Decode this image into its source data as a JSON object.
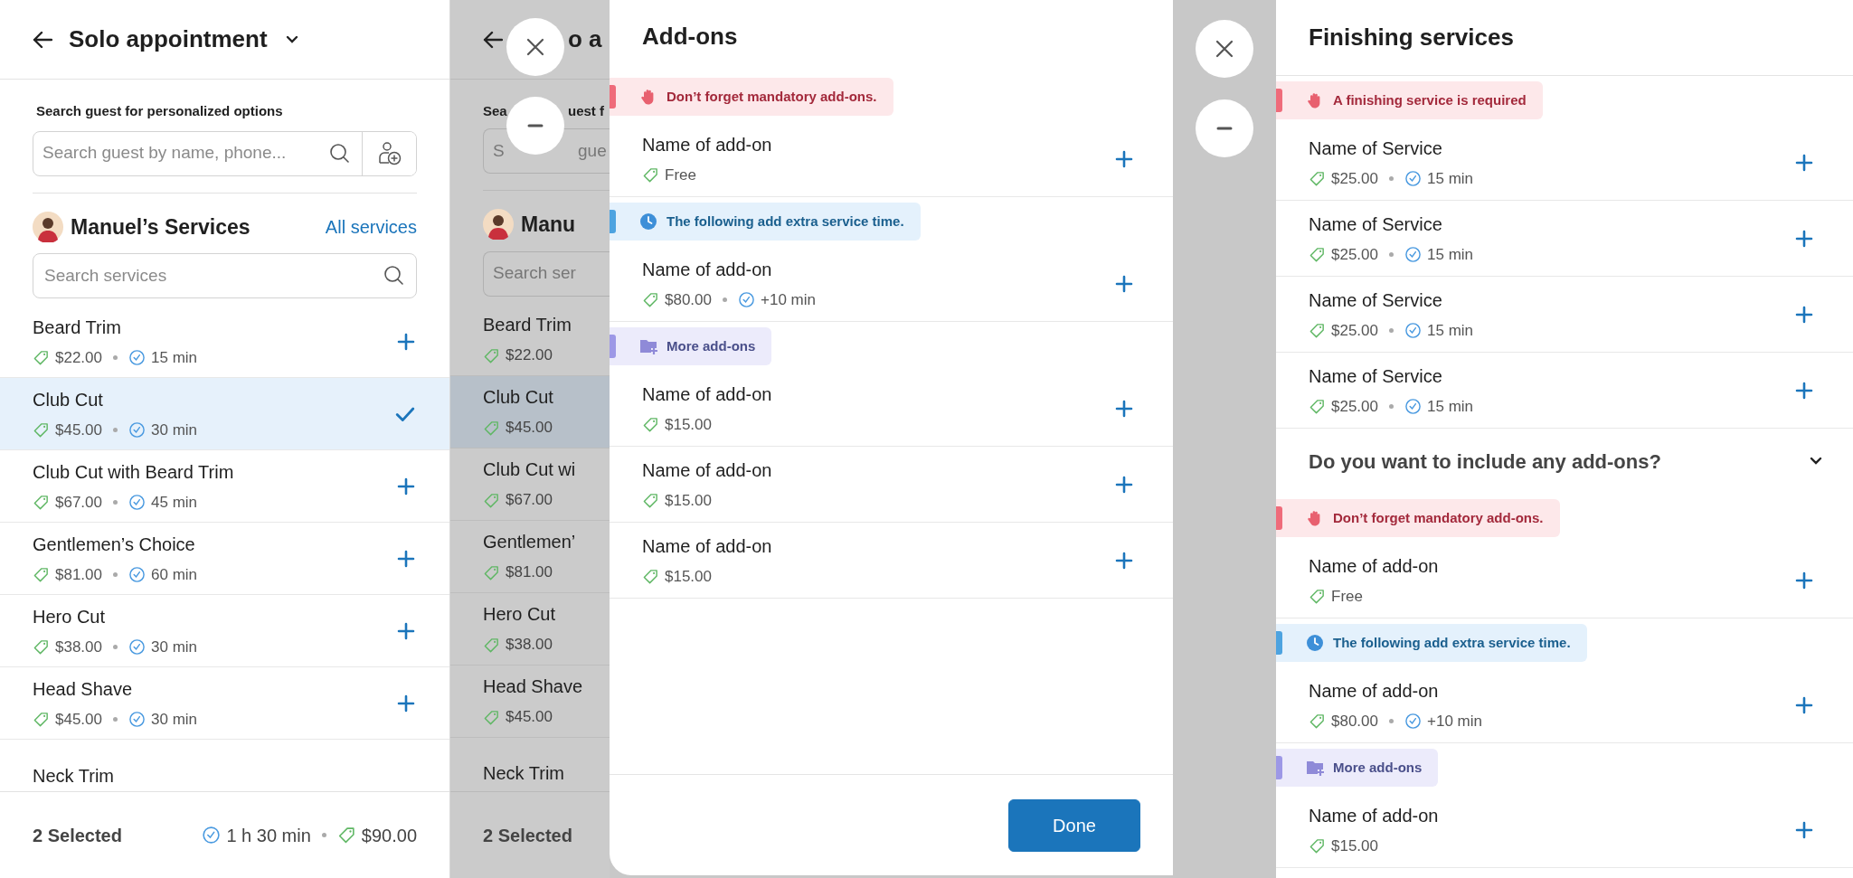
{
  "booking": {
    "title": "Solo appointment",
    "guest_label": "Search guest for personalized options",
    "guest_search": {
      "placeholder": "Search guest by name, phone..."
    },
    "staff_name": "Manuel’s Services",
    "all_services_link": "All services",
    "service_search": {
      "placeholder": "Search services"
    },
    "services": [
      {
        "name": "Beard Trim",
        "price": "$22.00",
        "duration": "15 min",
        "selected": false
      },
      {
        "name": "Club Cut",
        "price": "$45.00",
        "duration": "30 min",
        "selected": true
      },
      {
        "name": "Club Cut with Beard Trim",
        "price": "$67.00",
        "duration": "45 min",
        "selected": false
      },
      {
        "name": "Gentlemen’s Choice",
        "price": "$81.00",
        "duration": "60 min",
        "selected": false
      },
      {
        "name": "Hero Cut",
        "price": "$38.00",
        "duration": "30 min",
        "selected": false
      },
      {
        "name": "Head Shave",
        "price": "$45.00",
        "duration": "30 min",
        "selected": false
      },
      {
        "name": "Neck Trim",
        "selected": false
      }
    ],
    "footer": {
      "count": "2 Selected",
      "duration": "1 h 30 min",
      "price": "$90.00"
    }
  },
  "addons_screen": {
    "underlay": {
      "title": "o a",
      "guest_label": [
        "Sea",
        "uest f"
      ],
      "guest_search_text": [
        "S",
        "gue"
      ],
      "staff_name": "Manu",
      "service_search_text": "Search ser",
      "services": [
        {
          "name": "Beard Trim",
          "price": "$22.00",
          "selected": false
        },
        {
          "name": "Club Cut",
          "price": "$45.00",
          "selected": true
        },
        {
          "name": "Club Cut wi",
          "price": "$67.00",
          "selected": false
        },
        {
          "name": "Gentlemen’",
          "price": "$81.00",
          "selected": false
        },
        {
          "name": "Hero Cut",
          "price": "$38.00",
          "selected": false
        },
        {
          "name": "Head Shave",
          "price": "$45.00",
          "selected": false
        },
        {
          "name": "Neck Trim",
          "selected": false
        }
      ],
      "footer_count": "2 Selected"
    },
    "panel": {
      "title": "Add-ons",
      "sections": [
        {
          "banner": {
            "kind": "warning",
            "text": "Don’t forget mandatory add-ons."
          },
          "items": [
            {
              "name": "Name of add-on",
              "price": "Free"
            }
          ]
        },
        {
          "banner": {
            "kind": "info",
            "text": "The following add extra service time."
          },
          "items": [
            {
              "name": "Name of add-on",
              "price": "$80.00",
              "duration": "+10 min"
            }
          ]
        },
        {
          "banner": {
            "kind": "more",
            "text": "More add-ons"
          },
          "items": [
            {
              "name": "Name of add-on",
              "price": "$15.00"
            },
            {
              "name": "Name of add-on",
              "price": "$15.00"
            },
            {
              "name": "Name of add-on",
              "price": "$15.00"
            }
          ]
        }
      ],
      "done_button": "Done"
    }
  },
  "finishing_screen": {
    "title": "Finishing services",
    "banner": {
      "kind": "warning",
      "text": "A finishing service is required"
    },
    "services": [
      {
        "name": "Name of Service",
        "price": "$25.00",
        "duration": "15 min"
      },
      {
        "name": "Name of Service",
        "price": "$25.00",
        "duration": "15 min"
      },
      {
        "name": "Name of Service",
        "price": "$25.00",
        "duration": "15 min"
      },
      {
        "name": "Name of Service",
        "price": "$25.00",
        "duration": "15 min"
      }
    ],
    "addons_question": {
      "text": "Do you want to include any add-ons?",
      "expanded": true
    },
    "sections": [
      {
        "banner": {
          "kind": "warning",
          "text": "Don’t forget mandatory add-ons."
        },
        "items": [
          {
            "name": "Name of add-on",
            "price": "Free"
          }
        ]
      },
      {
        "banner": {
          "kind": "info",
          "text": "The following add extra service time."
        },
        "items": [
          {
            "name": "Name of add-on",
            "price": "$80.00",
            "duration": "+10 min"
          }
        ]
      },
      {
        "banner": {
          "kind": "more",
          "text": "More add-ons"
        },
        "items": [
          {
            "name": "Name of add-on",
            "price": "$15.00"
          }
        ]
      }
    ]
  }
}
